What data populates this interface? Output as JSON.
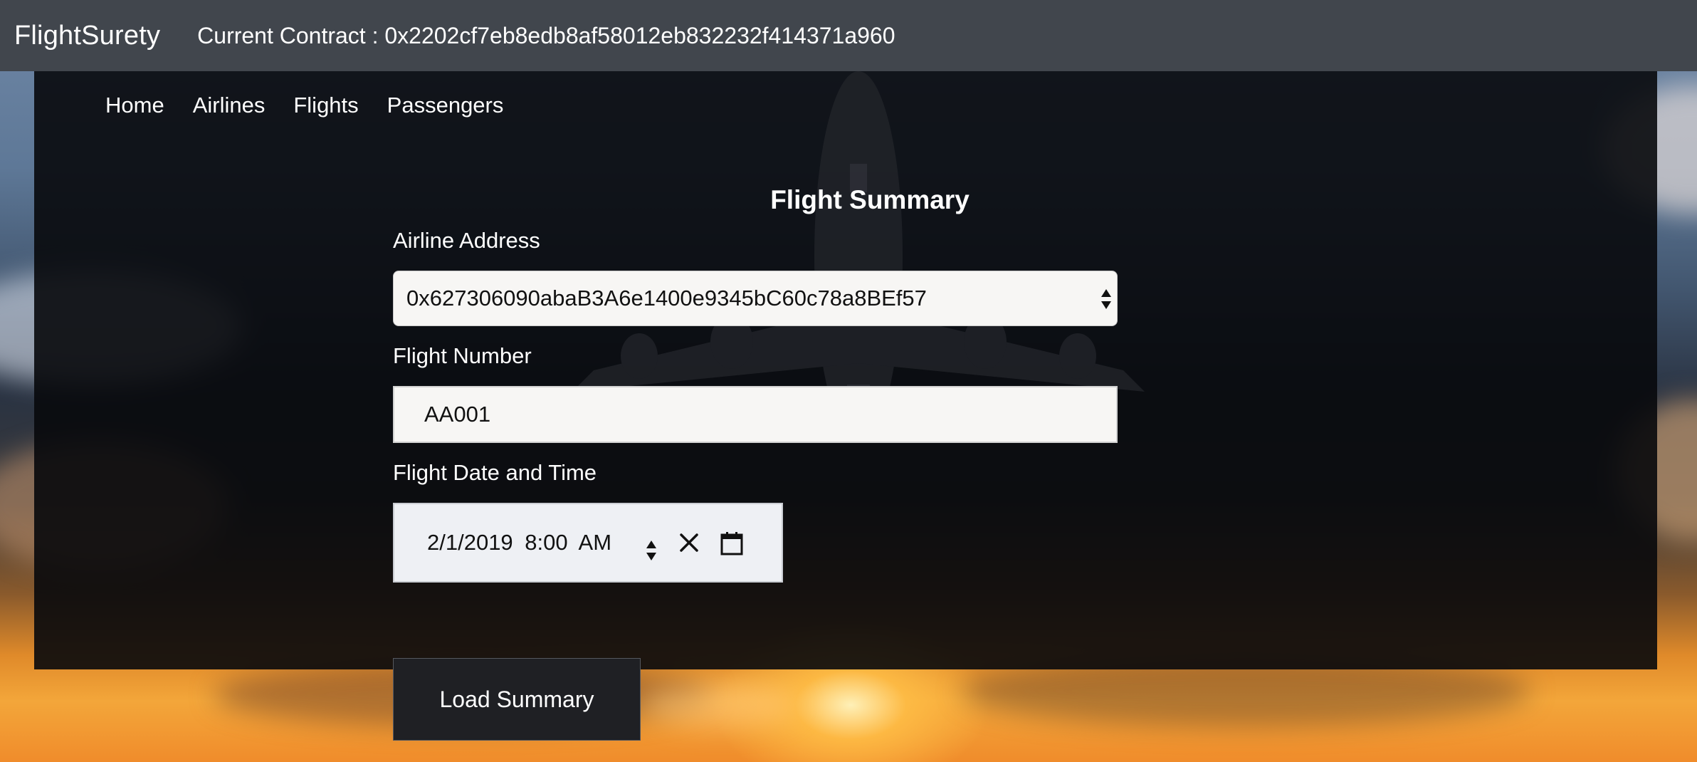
{
  "navbar": {
    "brand": "FlightSurety",
    "contract_text": "Current Contract : 0x2202cf7eb8edb8af58012eb832232f414371a960"
  },
  "subnav": {
    "items": [
      "Home",
      "Airlines",
      "Flights",
      "Passengers"
    ]
  },
  "form": {
    "title": "Flight Summary",
    "airline_label": "Airline Address",
    "airline_value": "0x627306090abaB3A6e1400e9345bC60c78a8BEf57",
    "flight_number_label": "Flight Number",
    "flight_number_value": "AA001",
    "datetime_label": "Flight Date and Time",
    "datetime_value": "2/1/2019 8:00 AM",
    "load_button": "Load Summary"
  },
  "icons": {
    "select": "updown-arrows-icon",
    "spinner": "spinner-arrows-icon",
    "clear": "close-icon",
    "calendar": "calendar-icon"
  },
  "colors": {
    "navbar": "#41464d",
    "panel": "#08090c",
    "button": "#1f2024",
    "input_bg": "#f7f6f4"
  }
}
